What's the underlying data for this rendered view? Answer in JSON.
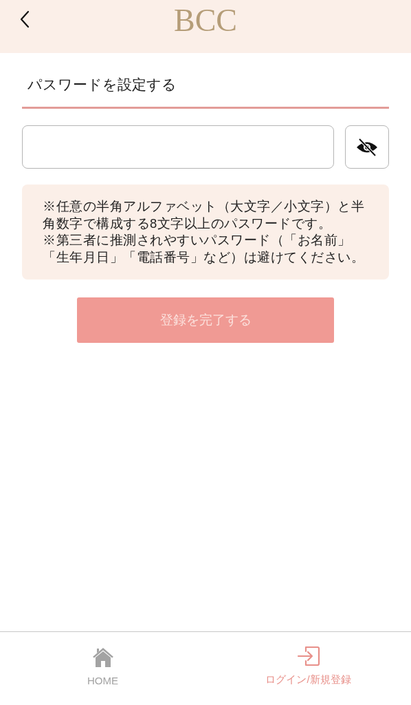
{
  "header": {
    "logo": "BCC"
  },
  "section": {
    "title": "パスワードを設定する"
  },
  "notes": [
    "※任意の半角アルファベット（大文字／小文字）と半角数字で構成する8文字以上のパスワードです。",
    "※第三者に推測されやすいパスワード（「お名前」「生年月日」「電話番号」など）は避けてください。"
  ],
  "submit": {
    "label": "登録を完了する",
    "disabled": true
  },
  "tab_bar": [
    {
      "kind": "home",
      "label": "HOME",
      "selected": false
    },
    {
      "kind": "login",
      "label": "ログイン/新規登録",
      "selected": true
    }
  ]
}
